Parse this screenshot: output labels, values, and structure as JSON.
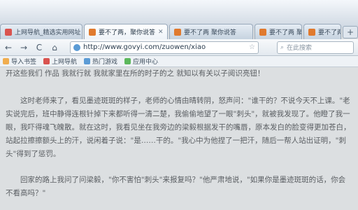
{
  "window": {
    "tabs": [
      {
        "label": "上网导航_精选实用网址",
        "color": "#d9534f",
        "active": false
      },
      {
        "label": "要不了两，聚你说答",
        "color": "#e07a2e",
        "active": true
      },
      {
        "label": "要不了两 聚你说答",
        "color": "#e07a2e",
        "active": false
      },
      {
        "label": "要不了两 聚你说答",
        "color": "#e07a2e",
        "active": false
      },
      {
        "label": "要不了两 聚你说答",
        "color": "#e07a2e",
        "active": false
      }
    ],
    "new_tab_label": "+"
  },
  "toolbar": {
    "back": "←",
    "forward": "→",
    "reload": "C",
    "home": "⌂",
    "url": "http://www.govyi.com/zuowen/xiao",
    "search_placeholder": "在此搜索"
  },
  "bookmarks": [
    {
      "label": "导入书签",
      "color": "#f0ad4e"
    },
    {
      "label": "上网导航",
      "color": "#d9534f"
    },
    {
      "label": "热门游戏",
      "color": "#5b9bd5"
    },
    {
      "label": "应用中心",
      "color": "#5cb85c"
    }
  ],
  "article": {
    "paragraphs": [
      "开这些我们 作品 我就行就 我就家里在所的时子的之 就知以有关以子阅识亮钮！",
      "这时老师来了，看见墨迹斑斑的样子，老师的心情由晴转阴，怒声问：\"谁干的？不说今天不上课。\"老实说完后，班中静得连根针掉下来都听得一清二楚，我偷偷地望了一眼\"刺头\"，就被我发现了。他瞪了我一眼，我吓得魂飞魄散。就在这时，我看见坐在我旁边的梁毅根据发干的嘴唇，原本发白的脸变得更加苍白，站起拉擦擦额头上的汗，说闲着子说：\"是……干的。\"我心中为他捏了一把汗，随后一帮人站出证明，\"刺头\"得到了惩罚。",
      "回家的路上我问了问梁毅，\"你不害怕\"刺头\"来报复吗？\"他严肃地说，\"如果你是墨迹斑斑的话，你会不看高吗？\""
    ]
  }
}
